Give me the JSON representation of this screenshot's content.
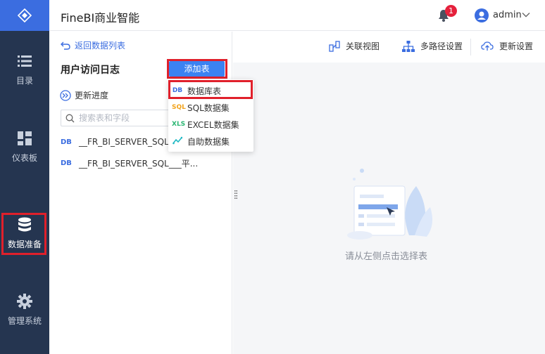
{
  "header": {
    "app_title": "FineBI商业智能",
    "notification_count": "1",
    "user_name": "admin"
  },
  "nav": {
    "items": [
      {
        "label": "目录",
        "icon": "list-icon"
      },
      {
        "label": "仪表板",
        "icon": "dashboard-icon"
      },
      {
        "label": "数据准备",
        "icon": "database-icon",
        "active": true
      },
      {
        "label": "管理系统",
        "icon": "gear-icon"
      }
    ]
  },
  "panel": {
    "back_label": "返回数据列表",
    "title": "用户访问日志",
    "update_progress_label": "更新进度",
    "search_placeholder": "搜索表和字段",
    "tables": [
      {
        "tag": "DB",
        "name": "__FR_BI_SERVER_SQL"
      },
      {
        "tag": "DB",
        "name": "__FR_BI_SERVER_SQL___平..."
      }
    ]
  },
  "add_table": {
    "button_label": "添加表",
    "menu": [
      {
        "icon_text": "DB",
        "label": "数据库表",
        "color": "#3b6de0"
      },
      {
        "icon_text": "SQL",
        "label": "SQL数据集",
        "color": "#f2a31b"
      },
      {
        "icon_text": "XLS",
        "label": "EXCEL数据集",
        "color": "#2bb673"
      },
      {
        "icon_text": "~",
        "label": "自助数据集",
        "color": "#20b9c4"
      }
    ]
  },
  "toolbar": {
    "relation_view": "关联视图",
    "multipath": "多路径设置",
    "update_settings": "更新设置"
  },
  "main": {
    "empty_hint": "请从左侧点击选择表"
  },
  "colors": {
    "accent": "#3b6de0",
    "nav_bg": "#253550",
    "highlight": "#e0202b"
  }
}
